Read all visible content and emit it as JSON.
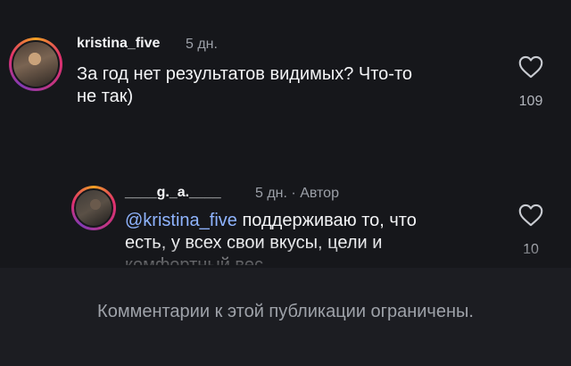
{
  "comments": [
    {
      "username": "kristina_five",
      "time": "5 дн.",
      "text_line1": "За год нет результатов видимых? Что-то",
      "text_line2": "не так)",
      "likes": "109",
      "heart_icon": "heart-outline-icon"
    },
    {
      "username": "____g._a.____",
      "time": "5 дн.",
      "separator": "·",
      "author_badge": "Автор",
      "mention": "@kristina_five",
      "text_line1_rest": " поддерживаю то, что",
      "text_line2": "есть, у всех свои вкусы, цели и",
      "text_line3_partial": "комфортный вес",
      "likes": "10",
      "heart_icon": "heart-outline-icon"
    }
  ],
  "footer": {
    "notice": "Комментарии к этой публикации ограничены."
  },
  "colors": {
    "background": "#16171b",
    "footer_background": "#1c1d22",
    "mention": "#8fb4ff",
    "secondary_text": "#9ca0a8"
  }
}
